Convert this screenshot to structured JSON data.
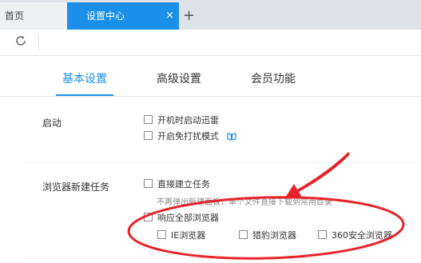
{
  "tabs": {
    "home_label": "首页",
    "active_label": "设置中心",
    "close_glyph": "×",
    "new_tab_glyph": "+"
  },
  "settings_tabs": [
    "基本设置",
    "高级设置",
    "会员功能"
  ],
  "sections": {
    "startup": {
      "label": "启动",
      "options": [
        "开机时启动迅雷",
        "开启免打扰模式"
      ]
    },
    "browser_new_task": {
      "label": "浏览器新建任务",
      "direct_create": "直接建立任务",
      "hint": "不再弹出新建面板，单个文件直接下载到常用目录",
      "respond_all": "响应全部浏览器",
      "browsers": [
        "IE浏览器",
        "猎豹浏览器",
        "360安全浏览器"
      ]
    }
  },
  "colors": {
    "accent": "#1a90ea",
    "annotation": "#e8242a"
  },
  "icons": {
    "reload": "reload-icon",
    "info": "info-book-icon"
  }
}
